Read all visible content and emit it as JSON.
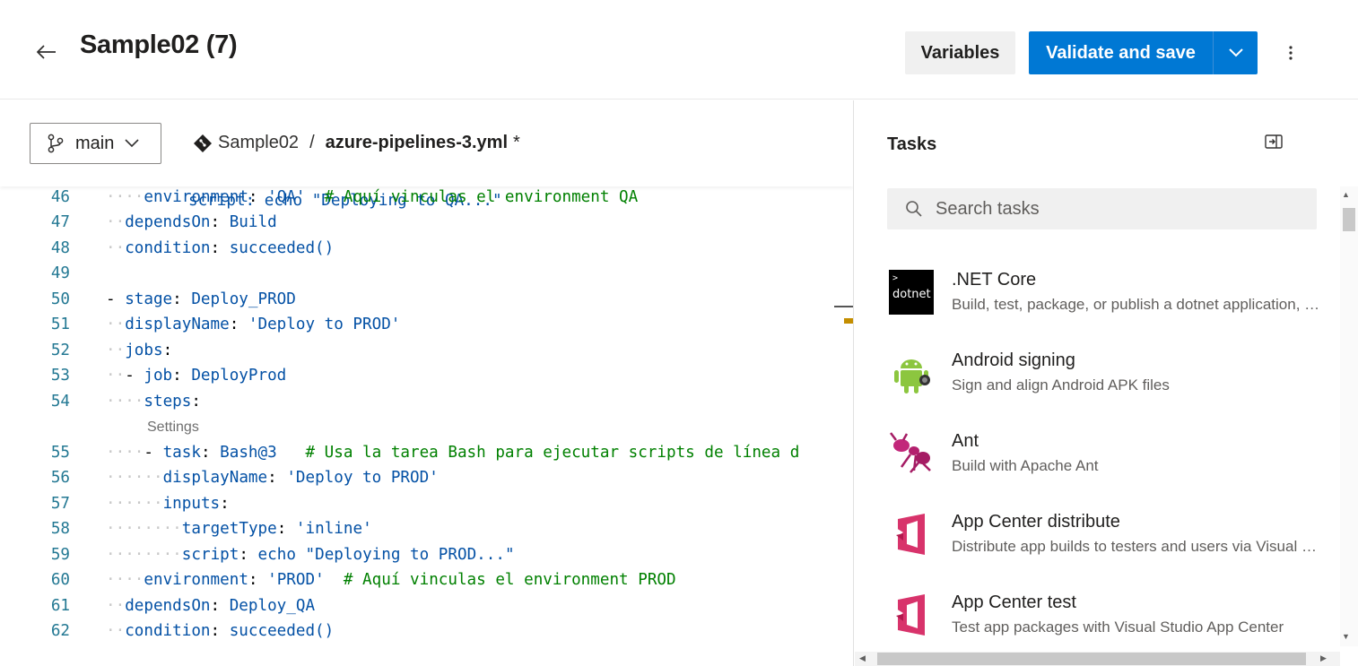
{
  "header": {
    "title": "Sample02 (7)",
    "variables_label": "Variables",
    "save_label": "Validate and save"
  },
  "toolbar": {
    "branch": "main",
    "repo": "Sample02",
    "separator": "/",
    "file": "azure-pipelines-3.yml",
    "modified_marker": "*"
  },
  "editor": {
    "top_partial_line": "script: echo \"Deploying to QA...\"",
    "settings_lens": "Settings",
    "lines": [
      {
        "n": "46",
        "text": "environment: 'QA'  # Aquí vinculas el environment QA"
      },
      {
        "n": "47",
        "text": "dependsOn: Build"
      },
      {
        "n": "48",
        "text": "condition: succeeded()"
      },
      {
        "n": "49",
        "text": ""
      },
      {
        "n": "50",
        "text": "- stage: Deploy_PROD"
      },
      {
        "n": "51",
        "text": "displayName: 'Deploy to PROD'"
      },
      {
        "n": "52",
        "text": "jobs:"
      },
      {
        "n": "53",
        "text": "- job: DeployProd"
      },
      {
        "n": "54",
        "text": "steps:"
      },
      {
        "n": "55",
        "text": "- task: Bash@3   # Usa la tarea Bash para ejecutar scripts de línea d"
      },
      {
        "n": "56",
        "text": "displayName: 'Deploy to PROD'"
      },
      {
        "n": "57",
        "text": "inputs:"
      },
      {
        "n": "58",
        "text": "targetType: 'inline'"
      },
      {
        "n": "59",
        "text": "script: echo \"Deploying to PROD...\""
      },
      {
        "n": "60",
        "text": "environment: 'PROD'  # Aquí vinculas el environment PROD"
      },
      {
        "n": "61",
        "text": "dependsOn: Deploy_QA"
      },
      {
        "n": "62",
        "text": "condition: succeeded()"
      }
    ]
  },
  "tasks": {
    "title": "Tasks",
    "search_placeholder": "Search tasks",
    "items": [
      {
        "name": ".NET Core",
        "desc": "Build, test, package, or publish a dotnet application, or run a custom dotnet command",
        "icon": "dotnet-icon",
        "icon_text": "dotnet"
      },
      {
        "name": "Android signing",
        "desc": "Sign and align Android APK files",
        "icon": "android-icon"
      },
      {
        "name": "Ant",
        "desc": "Build with Apache Ant",
        "icon": "ant-icon"
      },
      {
        "name": "App Center distribute",
        "desc": "Distribute app builds to testers and users via Visual Studio App Center",
        "icon": "app-center-icon"
      },
      {
        "name": "App Center test",
        "desc": "Test app packages with Visual Studio App Center",
        "icon": "app-center-icon"
      }
    ]
  },
  "colors": {
    "accent": "#0078d4",
    "line_number": "#237893",
    "yaml_key": "#0451a5",
    "comment": "#008000"
  }
}
